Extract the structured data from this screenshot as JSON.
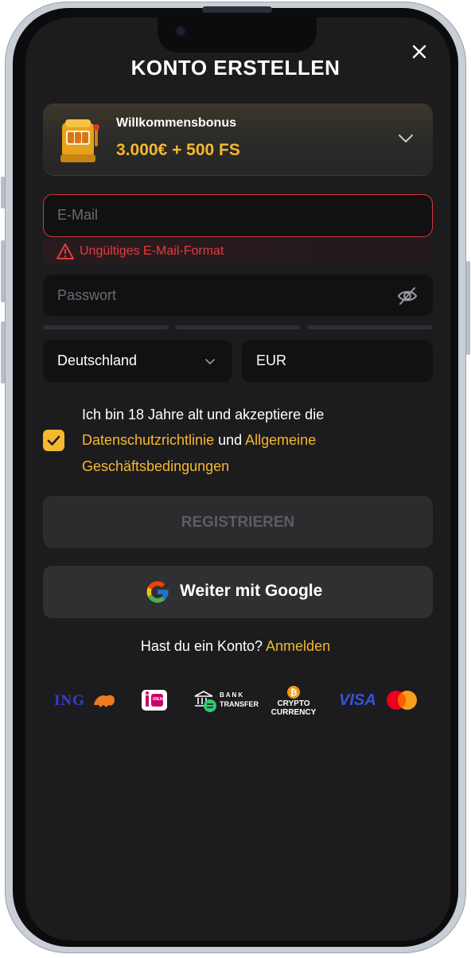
{
  "header": {
    "title": "KONTO ERSTELLEN",
    "close_icon": "close-icon"
  },
  "bonus": {
    "label": "Willkommensbonus",
    "value": "3.000€ + 500 FS",
    "icon": "slot-machine-icon"
  },
  "form": {
    "email_placeholder": "E-Mail",
    "email_error": "Ungültiges E-Mail-Format",
    "password_placeholder": "Passwort",
    "country": "Deutschland",
    "currency": "EUR",
    "consent_prefix": "Ich bin 18 Jahre alt und akzeptiere die",
    "privacy_link": "Datenschutzrichtlinie",
    "consent_and": "und",
    "terms_link_1": "Allgemeine",
    "terms_link_2": "Geschäftsbedingungen",
    "consent_checked": true
  },
  "buttons": {
    "register": "REGISTRIEREN",
    "google": "Weiter mit Google"
  },
  "login": {
    "prompt": "Hast du ein Konto?",
    "link": "Anmelden"
  },
  "payments": {
    "ing": "ING",
    "ideal": "iDEAL",
    "bank_1": "BANK",
    "bank_2": "TRANSFER",
    "crypto_1": "CRYPTO",
    "crypto_2": "CURRENCY",
    "visa": "VISA"
  },
  "colors": {
    "accent": "#f6b731",
    "error": "#e53b40",
    "background": "#1c1c1e"
  }
}
